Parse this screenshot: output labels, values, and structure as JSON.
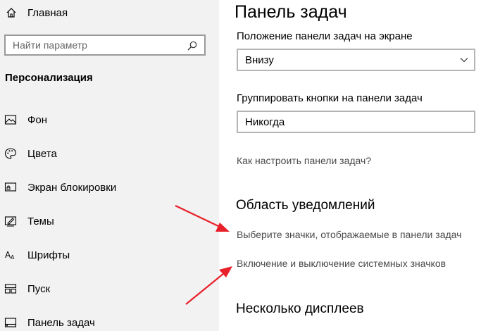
{
  "sidebar": {
    "home_label": "Главная",
    "search_placeholder": "Найти параметр",
    "section_title": "Персонализация",
    "items": [
      {
        "label": "Фон",
        "icon": "picture-icon"
      },
      {
        "label": "Цвета",
        "icon": "palette-icon"
      },
      {
        "label": "Экран блокировки",
        "icon": "lock-screen-icon"
      },
      {
        "label": "Темы",
        "icon": "themes-icon"
      },
      {
        "label": "Шрифты",
        "icon": "fonts-icon"
      },
      {
        "label": "Пуск",
        "icon": "start-icon"
      },
      {
        "label": "Панель задач",
        "icon": "taskbar-icon"
      }
    ]
  },
  "main": {
    "title": "Панель задач",
    "position_label": "Положение панели задач на экране",
    "position_value": "Внизу",
    "group_label": "Группировать кнопки на панели задач",
    "group_value": "Никогда",
    "howto_link": "Как настроить панели задач?",
    "notification_heading": "Область уведомлений",
    "notification_links": [
      "Выберите значки, отображаемые в панели задач",
      "Включение и выключение системных значков"
    ],
    "multi_display_heading": "Несколько дисплеев"
  },
  "colors": {
    "sidebar_bg": "#f2f2f2",
    "arrow": "#e8202a",
    "link": "#4a4a4a"
  }
}
